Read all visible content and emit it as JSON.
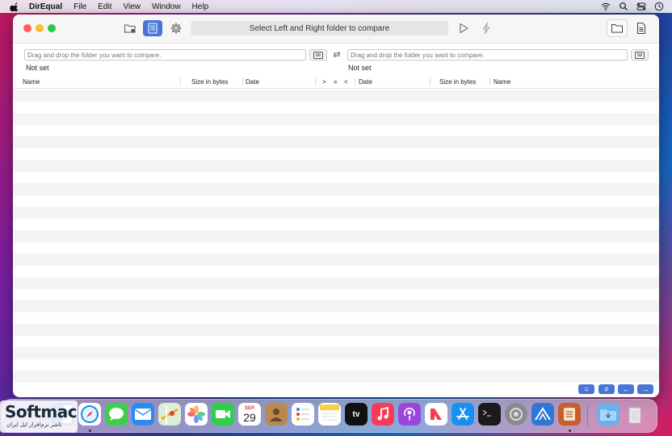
{
  "menubar": {
    "app_name": "DirEqual",
    "items": [
      "File",
      "Edit",
      "View",
      "Window",
      "Help"
    ]
  },
  "toolbar": {
    "status_text": "Select Left and Right folder to compare"
  },
  "left_panel": {
    "path_placeholder": "Drag and drop the folder you want to compare.",
    "status": "Not set"
  },
  "right_panel": {
    "path_placeholder": "Drag and drop the folder you want to compare.",
    "status": "Not set"
  },
  "columns": {
    "left": [
      "Name",
      "Size in bytes",
      "Date"
    ],
    "compare": [
      ">",
      "=",
      "<"
    ],
    "right": [
      "Date",
      "Size in bytes",
      "Name"
    ]
  },
  "bottom_buttons": [
    "=",
    "≠",
    "←",
    "→"
  ],
  "dock": {
    "calendar_month": "SEP",
    "calendar_day": "29",
    "tv_label": "tv"
  },
  "watermark": {
    "title": "Softmac",
    "subtitle": "ناشر نرم‌افزار اپل ایران"
  },
  "colors": {
    "accent": "#4a75d8",
    "row_alt": "#f4f4f5"
  }
}
